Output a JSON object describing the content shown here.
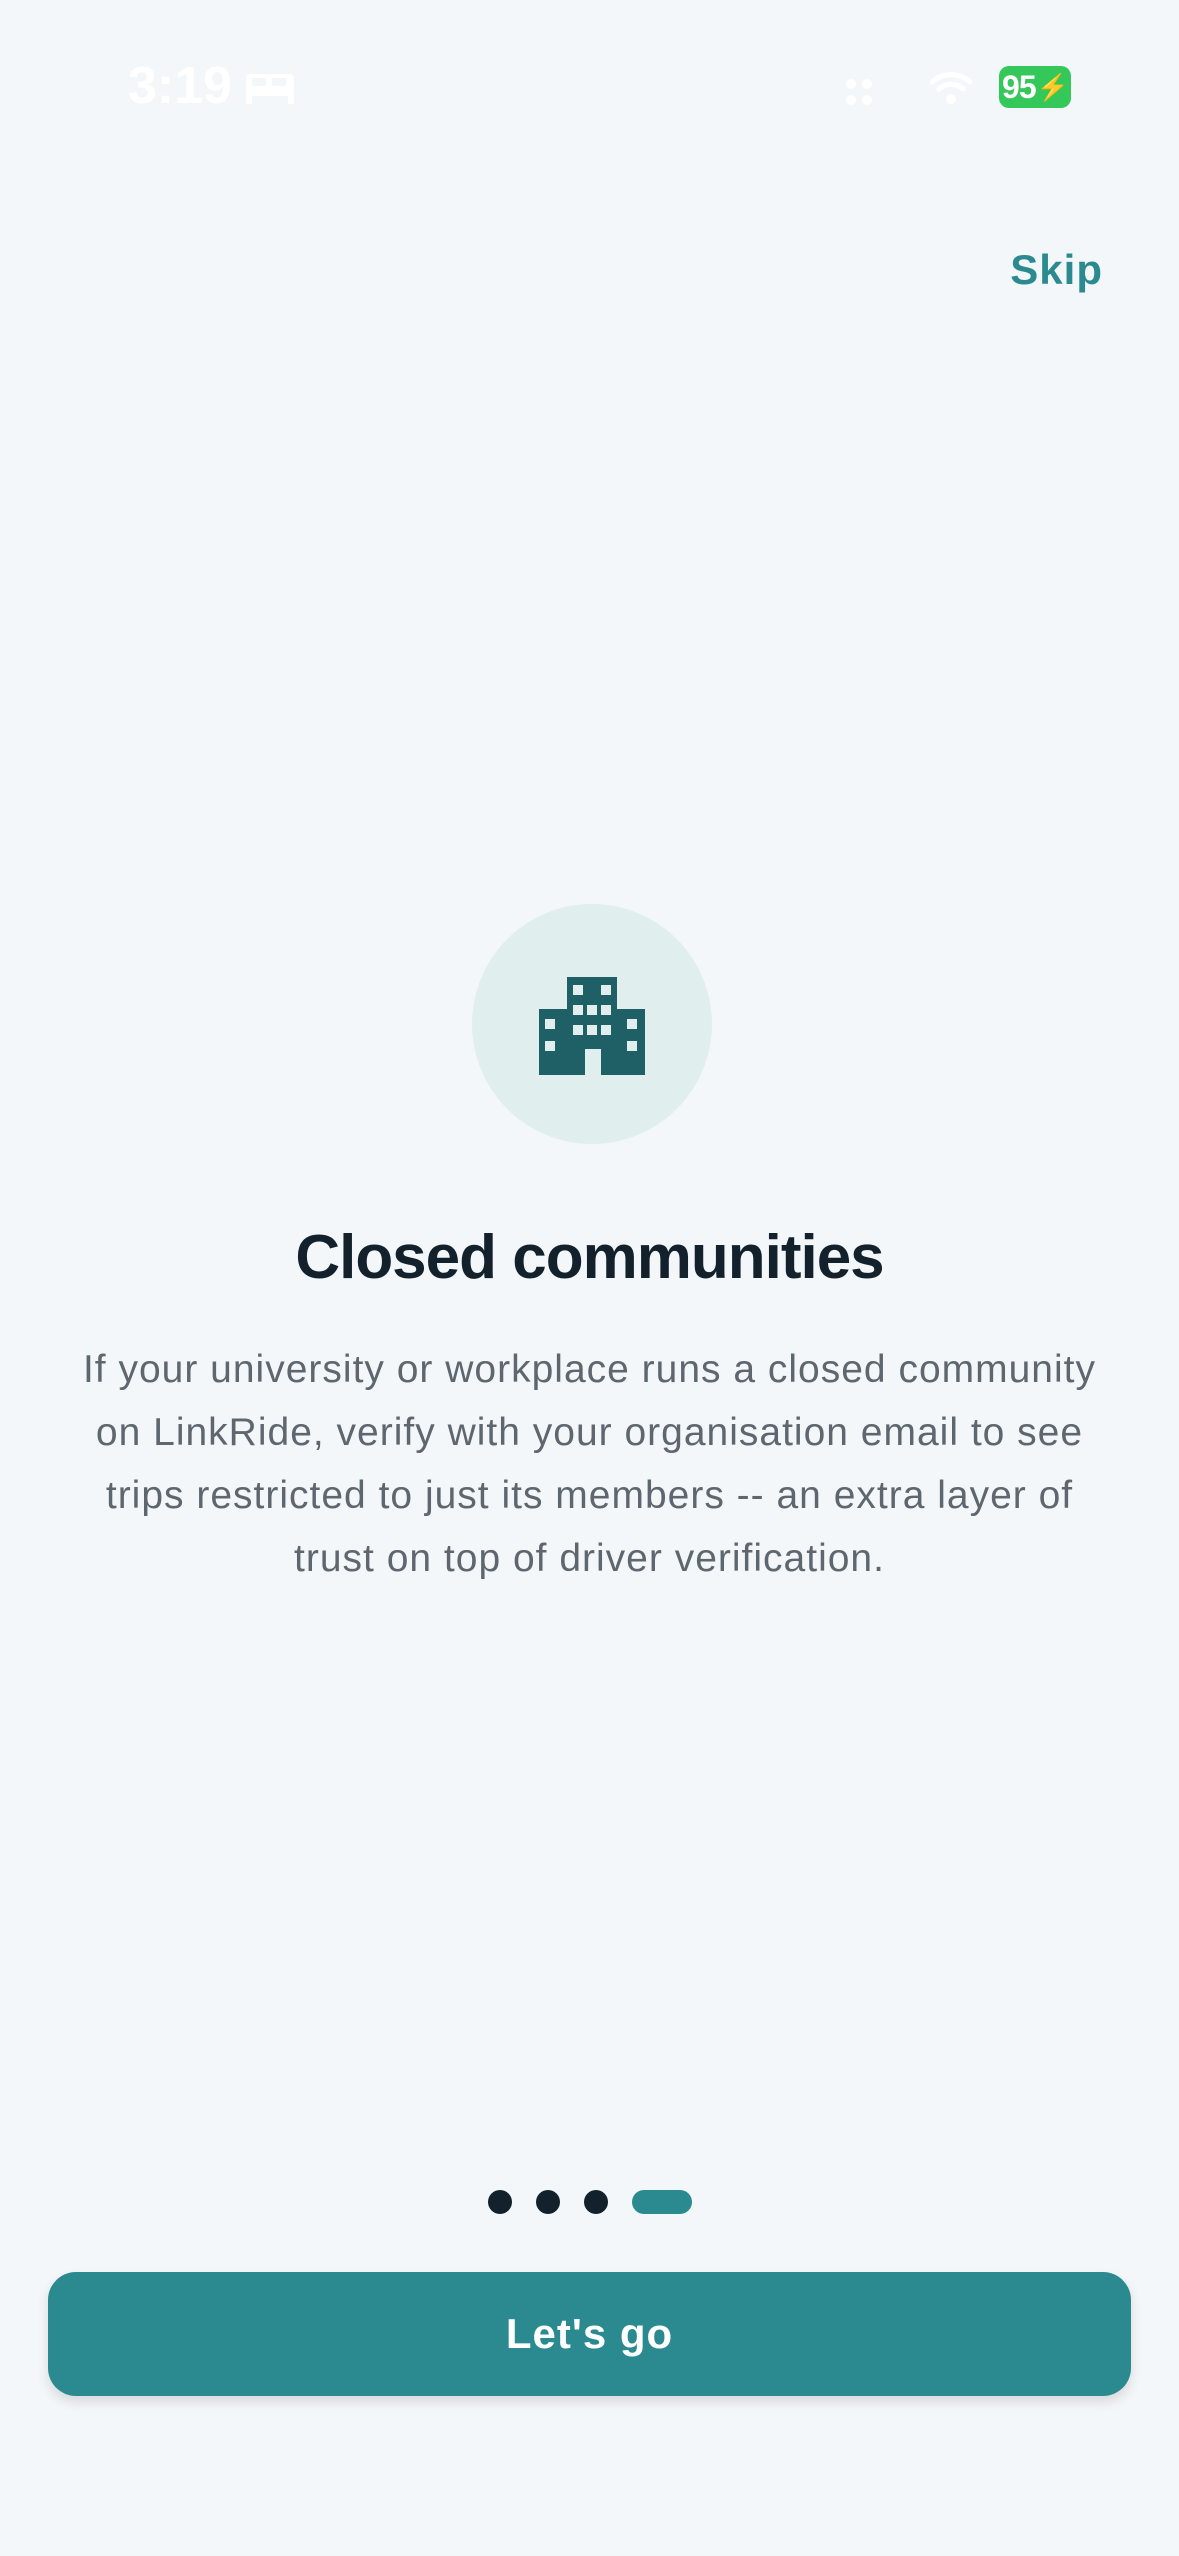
{
  "status_bar": {
    "time": "3:19",
    "battery_level": "95",
    "battery_charging": true,
    "icons": [
      "bed-icon",
      "signal-icon",
      "wifi-icon",
      "battery-icon"
    ]
  },
  "header": {
    "skip_label": "Skip"
  },
  "slide": {
    "icon": "building-icon",
    "title": "Closed communities",
    "description": "If your university or workplace runs a closed community on LinkRide, verify with your organisation email to see trips restricted to just its members -- an extra layer of trust on top of driver verification."
  },
  "pagination": {
    "total": 4,
    "current": 4
  },
  "footer": {
    "cta_label": "Let's go"
  },
  "colors": {
    "accent": "#2a8a90",
    "background": "#f4f7f9",
    "title": "#13212d",
    "body_text": "#5e6770",
    "icon_bg": "#e1eeee",
    "icon": "#1f5f66",
    "battery": "#34c759"
  }
}
